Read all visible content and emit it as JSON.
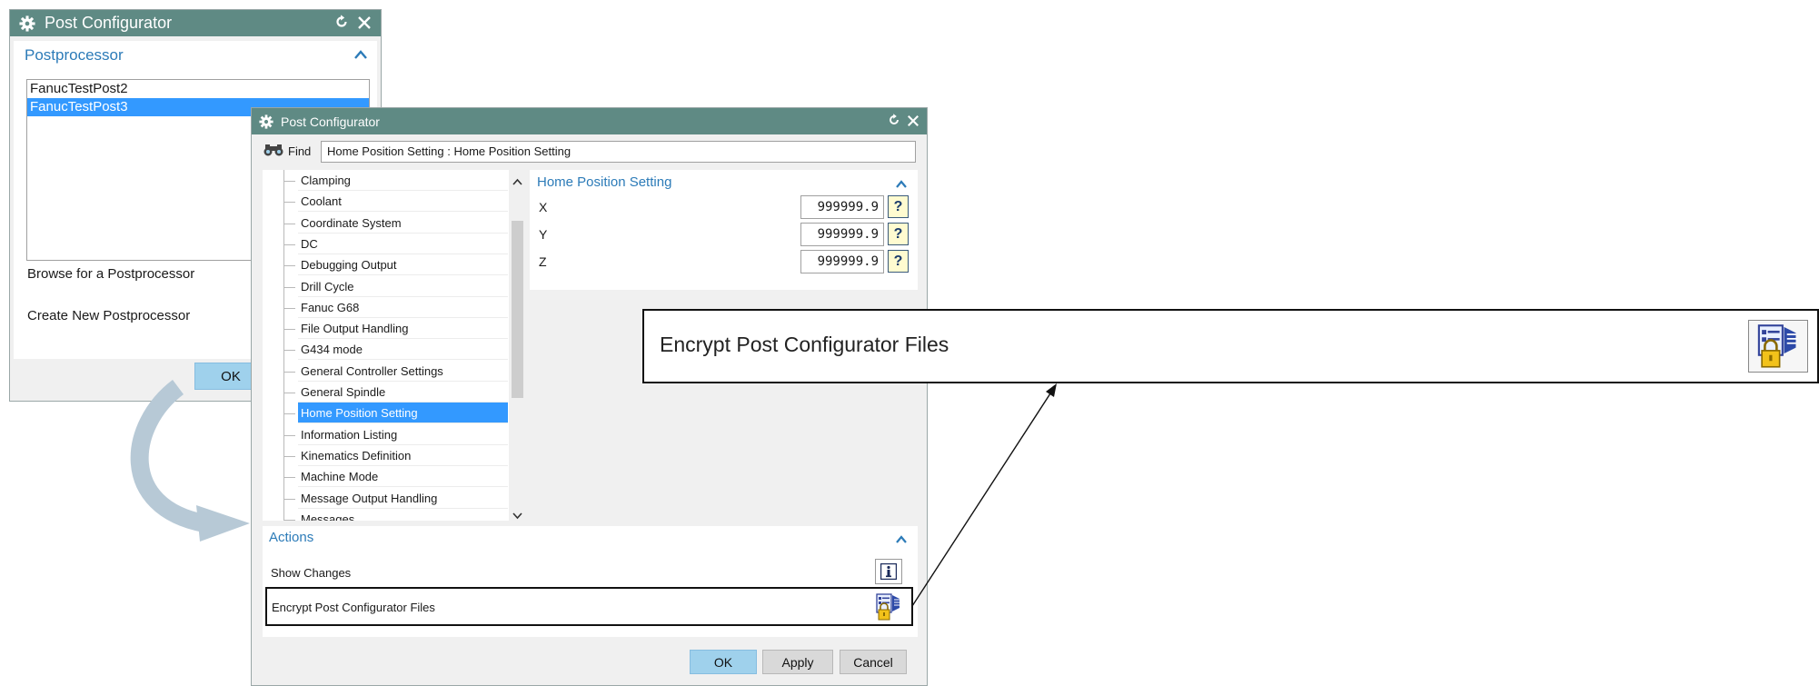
{
  "dialog1": {
    "title": "Post Configurator",
    "section_title": "Postprocessor",
    "list_items": [
      "FanucTestPost2",
      "FanucTestPost3"
    ],
    "selected_index": 1,
    "browse_label": "Browse for a Postprocessor",
    "create_label": "Create New Postprocessor",
    "ok_label": "OK"
  },
  "dialog2": {
    "title": "Post Configurator",
    "find_label": "Find",
    "find_value": "Home Position Setting : Home Position Setting",
    "tree_items": [
      "Clamping",
      "Coolant",
      "Coordinate System",
      "DC",
      "Debugging Output",
      "Drill Cycle",
      "Fanuc G68",
      "File Output Handling",
      "G434 mode",
      "General Controller Settings",
      "General Spindle",
      "Home Position Setting",
      "Information Listing",
      "Kinematics Definition",
      "Machine Mode",
      "Message Output Handling",
      "Messages"
    ],
    "selected_tree_index": 11,
    "home_section_title": "Home Position Setting",
    "coords": [
      {
        "label": "X",
        "value": "999999.9"
      },
      {
        "label": "Y",
        "value": "999999.9"
      },
      {
        "label": "Z",
        "value": "999999.9"
      }
    ],
    "actions_title": "Actions",
    "show_changes_label": "Show Changes",
    "encrypt_label": "Encrypt Post Configurator Files",
    "ok_label": "OK",
    "apply_label": "Apply",
    "cancel_label": "Cancel"
  },
  "callout": {
    "label": "Encrypt Post Configurator Files"
  },
  "icons": {
    "gear": "gear-icon",
    "reset": "reset-icon",
    "close": "close-icon",
    "collapse": "chevron-up-icon",
    "find": "binoculars-icon",
    "help": "help-icon",
    "info": "info-icon",
    "encrypt": "encrypt-lock-icon",
    "scroll_up": "chevron-up-small-icon",
    "scroll_down": "chevron-down-small-icon"
  },
  "colors": {
    "titlebar": "#5f8a84",
    "section_heading": "#2c7bb8",
    "selection": "#3399ff",
    "primary_button": "#9fd1ec",
    "flow_arrow": "#b7c9d6"
  }
}
